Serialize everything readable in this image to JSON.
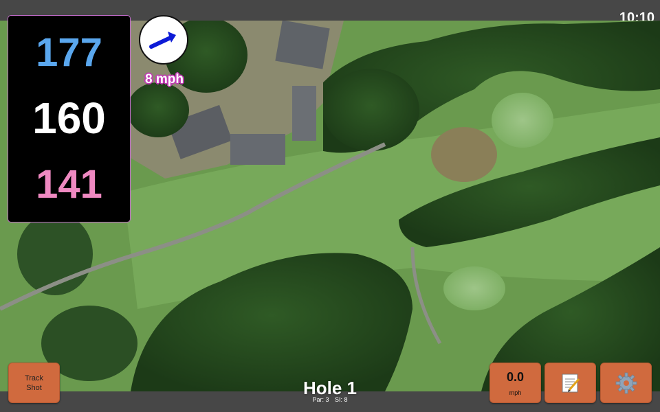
{
  "status_bar": {
    "time": "10:10"
  },
  "distances": {
    "back": "177",
    "middle": "160",
    "front": "141"
  },
  "wind": {
    "speed_label": "8 mph",
    "direction_icon": "arrow-icon"
  },
  "buttons": {
    "track_shot": "Track Shot",
    "speed_value": "0.0",
    "speed_unit": "mph",
    "notes_icon": "notepad-icon",
    "settings_icon": "gear-icon"
  },
  "hole": {
    "title": "Hole 1",
    "par": "Par: 3",
    "si": "SI: 8"
  },
  "colors": {
    "back_distance": "#5aa7ee",
    "middle_distance": "#ffffff",
    "front_distance": "#ef89c1",
    "button_bg": "#d06a3e",
    "wind_outline": "#c03bb3"
  }
}
